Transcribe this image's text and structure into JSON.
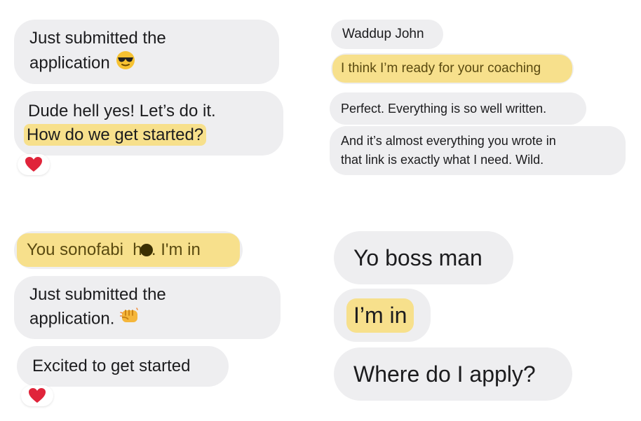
{
  "panels": {
    "top_left": {
      "msg1": "Just submitted the\napplication",
      "msg2_line1": "Dude hell yes! Let’s do it.",
      "msg2_line2": "How do we get started?"
    },
    "top_right": {
      "msg1": "Waddup John",
      "msg2": "I think I’m ready for your coaching",
      "msg3": "Perfect. Everything is so well written.",
      "msg4": "And it’s almost everything you wrote in\nthat link is exactly what I need. Wild."
    },
    "bottom_left": {
      "msg1": "You sonofabi  h... I'm in",
      "msg2": "Just submitted the\napplication.",
      "msg3": "Excited to get started"
    },
    "bottom_right": {
      "msg1": "Yo boss man",
      "msg2": "I’m in",
      "msg3": "Where do I apply?"
    }
  },
  "icons": {
    "sunglasses_emoji": "sunglasses-icon",
    "fist_emoji": "fist-bump-icon",
    "heart_reaction": "heart-icon"
  },
  "colors": {
    "bubble": "#eeeef0",
    "highlight": "#f7e08c",
    "heart": "#e0243a"
  }
}
